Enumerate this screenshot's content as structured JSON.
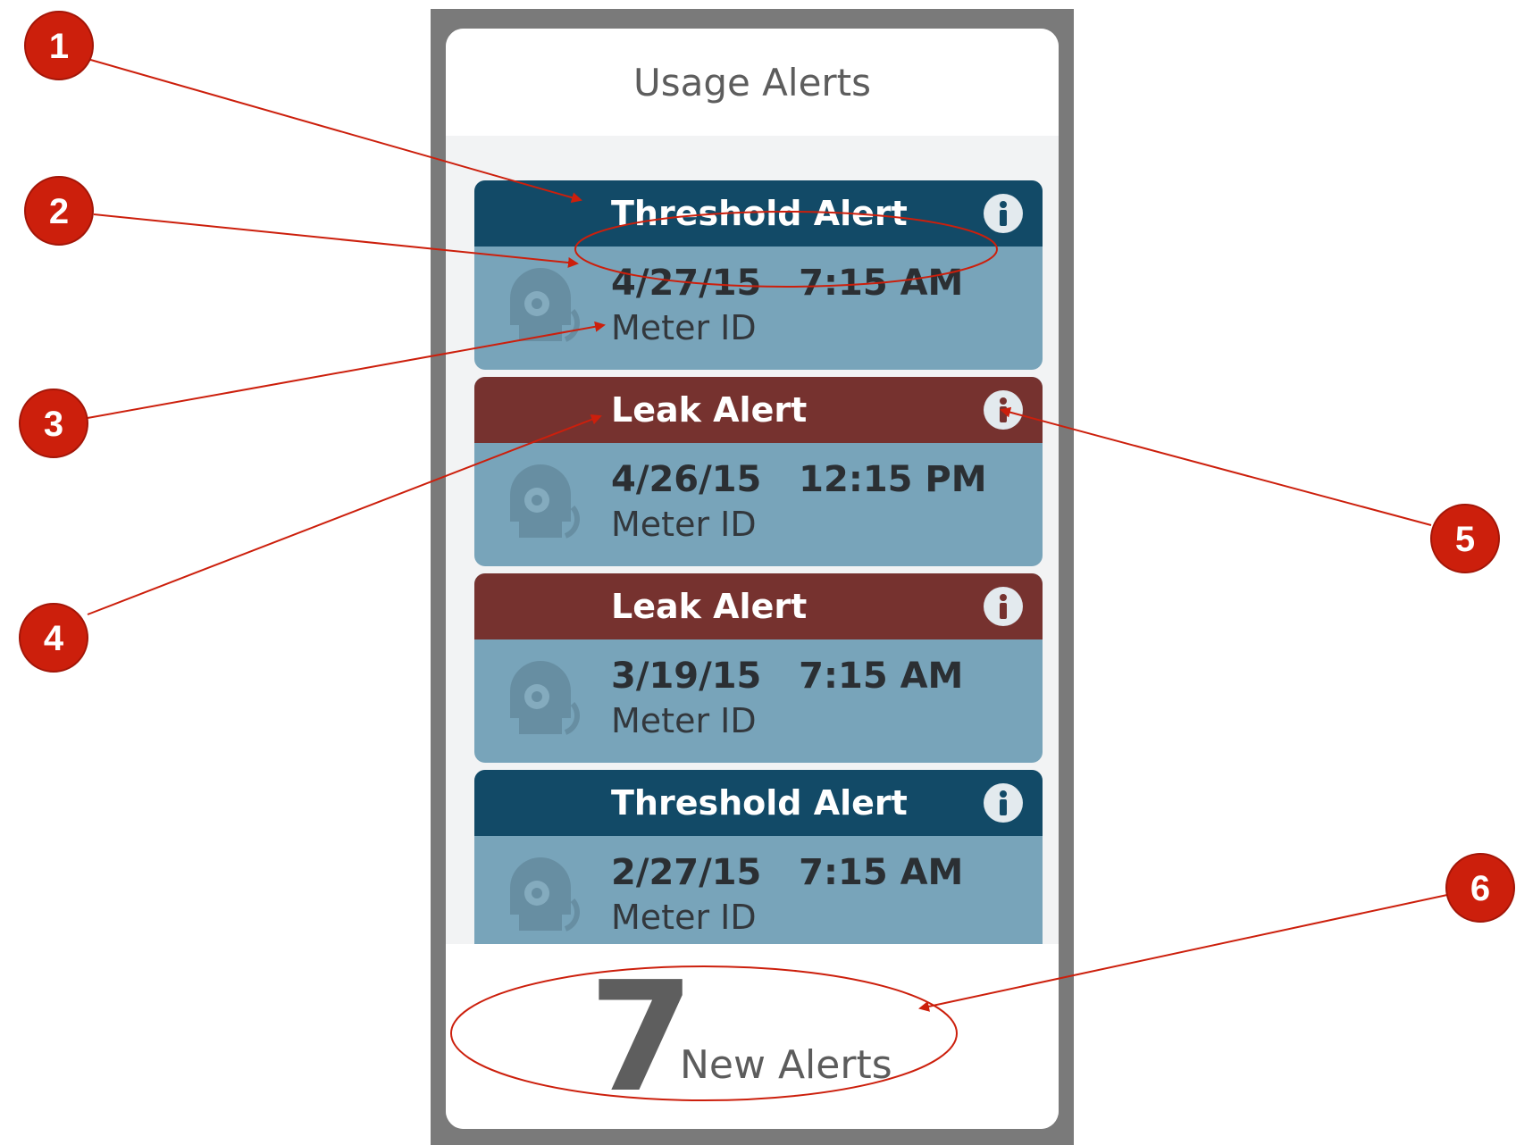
{
  "screen": {
    "title": "Usage Alerts"
  },
  "alerts": [
    {
      "type": "Threshold Alert",
      "kind": "threshold",
      "date": "4/27/15",
      "time": "7:15 AM",
      "meter": "Meter ID",
      "info_icon": "info-icon"
    },
    {
      "type": "Leak Alert",
      "kind": "leak",
      "date": "4/26/15",
      "time": "12:15 PM",
      "meter": "Meter ID",
      "info_icon": "info-icon"
    },
    {
      "type": "Leak Alert",
      "kind": "leak",
      "date": "3/19/15",
      "time": "7:15 AM",
      "meter": "Meter ID",
      "info_icon": "info-icon"
    },
    {
      "type": "Threshold Alert",
      "kind": "threshold",
      "date": "2/27/15",
      "time": "7:15 AM",
      "meter": "Meter ID",
      "info_icon": "info-icon"
    }
  ],
  "footer": {
    "count": "7",
    "label": "New Alerts"
  },
  "annotations": {
    "badges": [
      "1",
      "2",
      "3",
      "4",
      "5",
      "6"
    ]
  },
  "colors": {
    "threshold_header": "#124a67",
    "leak_header": "#76322f",
    "card_body": "#78a4ba",
    "annotation_red": "#cc1f0c"
  }
}
